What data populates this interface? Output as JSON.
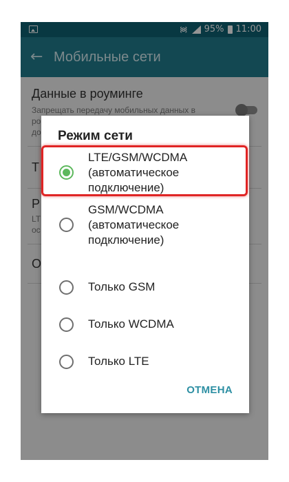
{
  "status_bar": {
    "battery": "95%",
    "time": "11:00"
  },
  "app_bar": {
    "title": "Мобильные сети"
  },
  "settings": {
    "roaming_title": "Данные в роуминге",
    "roaming_desc": [
      "Запрещать передачу мобильных данных в",
      "ро",
      "до"
    ],
    "item2_title": "Т",
    "item3_title": "Р",
    "item3_desc": [
      "LT",
      "ос"
    ],
    "item4_title": "О"
  },
  "dialog": {
    "title": "Режим сети",
    "options": [
      {
        "label": "LTE/GSM/WCDMA (автоматическое подключение)",
        "selected": true
      },
      {
        "label": "GSM/WCDMA (автоматическое подключение)",
        "selected": false
      },
      {
        "label": "Только GSM",
        "selected": false
      },
      {
        "label": "Только WCDMA",
        "selected": false
      },
      {
        "label": "Только LTE",
        "selected": false
      }
    ],
    "cancel_label": "ОТМЕНА"
  },
  "colors": {
    "status_bar": "#0e6173",
    "app_bar": "#217c8e",
    "selected_radio": "#5cb85c",
    "highlight": "#e02424",
    "cancel": "#2d8fa3"
  }
}
